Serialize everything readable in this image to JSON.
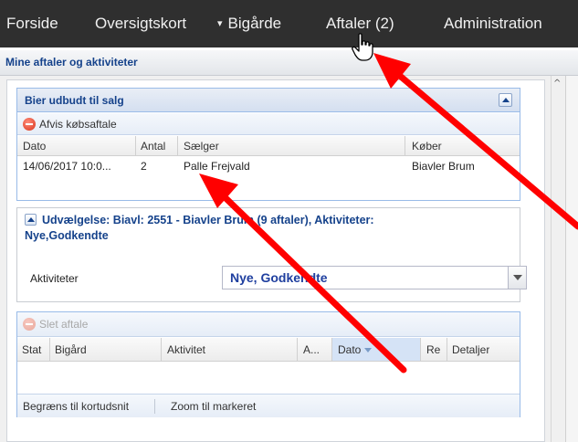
{
  "nav": {
    "items": [
      {
        "label": "Forside"
      },
      {
        "label": "Oversigtskort"
      },
      {
        "label": "Bigårde"
      },
      {
        "label": "Aftaler (2)"
      },
      {
        "label": "Administration"
      }
    ]
  },
  "header": {
    "title": "Mine aftaler og aktiviteter"
  },
  "sale_panel": {
    "title": "Bier udbudt til salg",
    "reject_button": "Afvis købsaftale",
    "columns": [
      "Dato",
      "Antal",
      "Sælger",
      "Køber"
    ],
    "rows": [
      {
        "dato": "14/06/2017 10:0...",
        "antal": "2",
        "saelger": "Palle Frejvald",
        "koeber": "Biavler Brum"
      }
    ]
  },
  "selection": {
    "legend_line1": "Udvælgelse: Biavl: 2551 - Biavler Brum (9 aftaler), Aktiviteter:",
    "legend_line2": "Nye,Godkendte",
    "activities_label": "Aktiviteter",
    "activities_value": "Nye, Godkendte"
  },
  "agreements_panel": {
    "delete_button": "Slet aftale",
    "columns": [
      "Stat",
      "Bigård",
      "Aktivitet",
      "A...",
      "Dato",
      "Re",
      "Detaljer"
    ],
    "bottom_buttons": [
      "Begræns til kortudsnit",
      "Zoom til markeret"
    ]
  },
  "colors": {
    "nav_bg": "#2f2f2f",
    "title_blue": "#15428b",
    "panel_border": "#99bbe8",
    "annotation_arrow": "#ff0000"
  }
}
